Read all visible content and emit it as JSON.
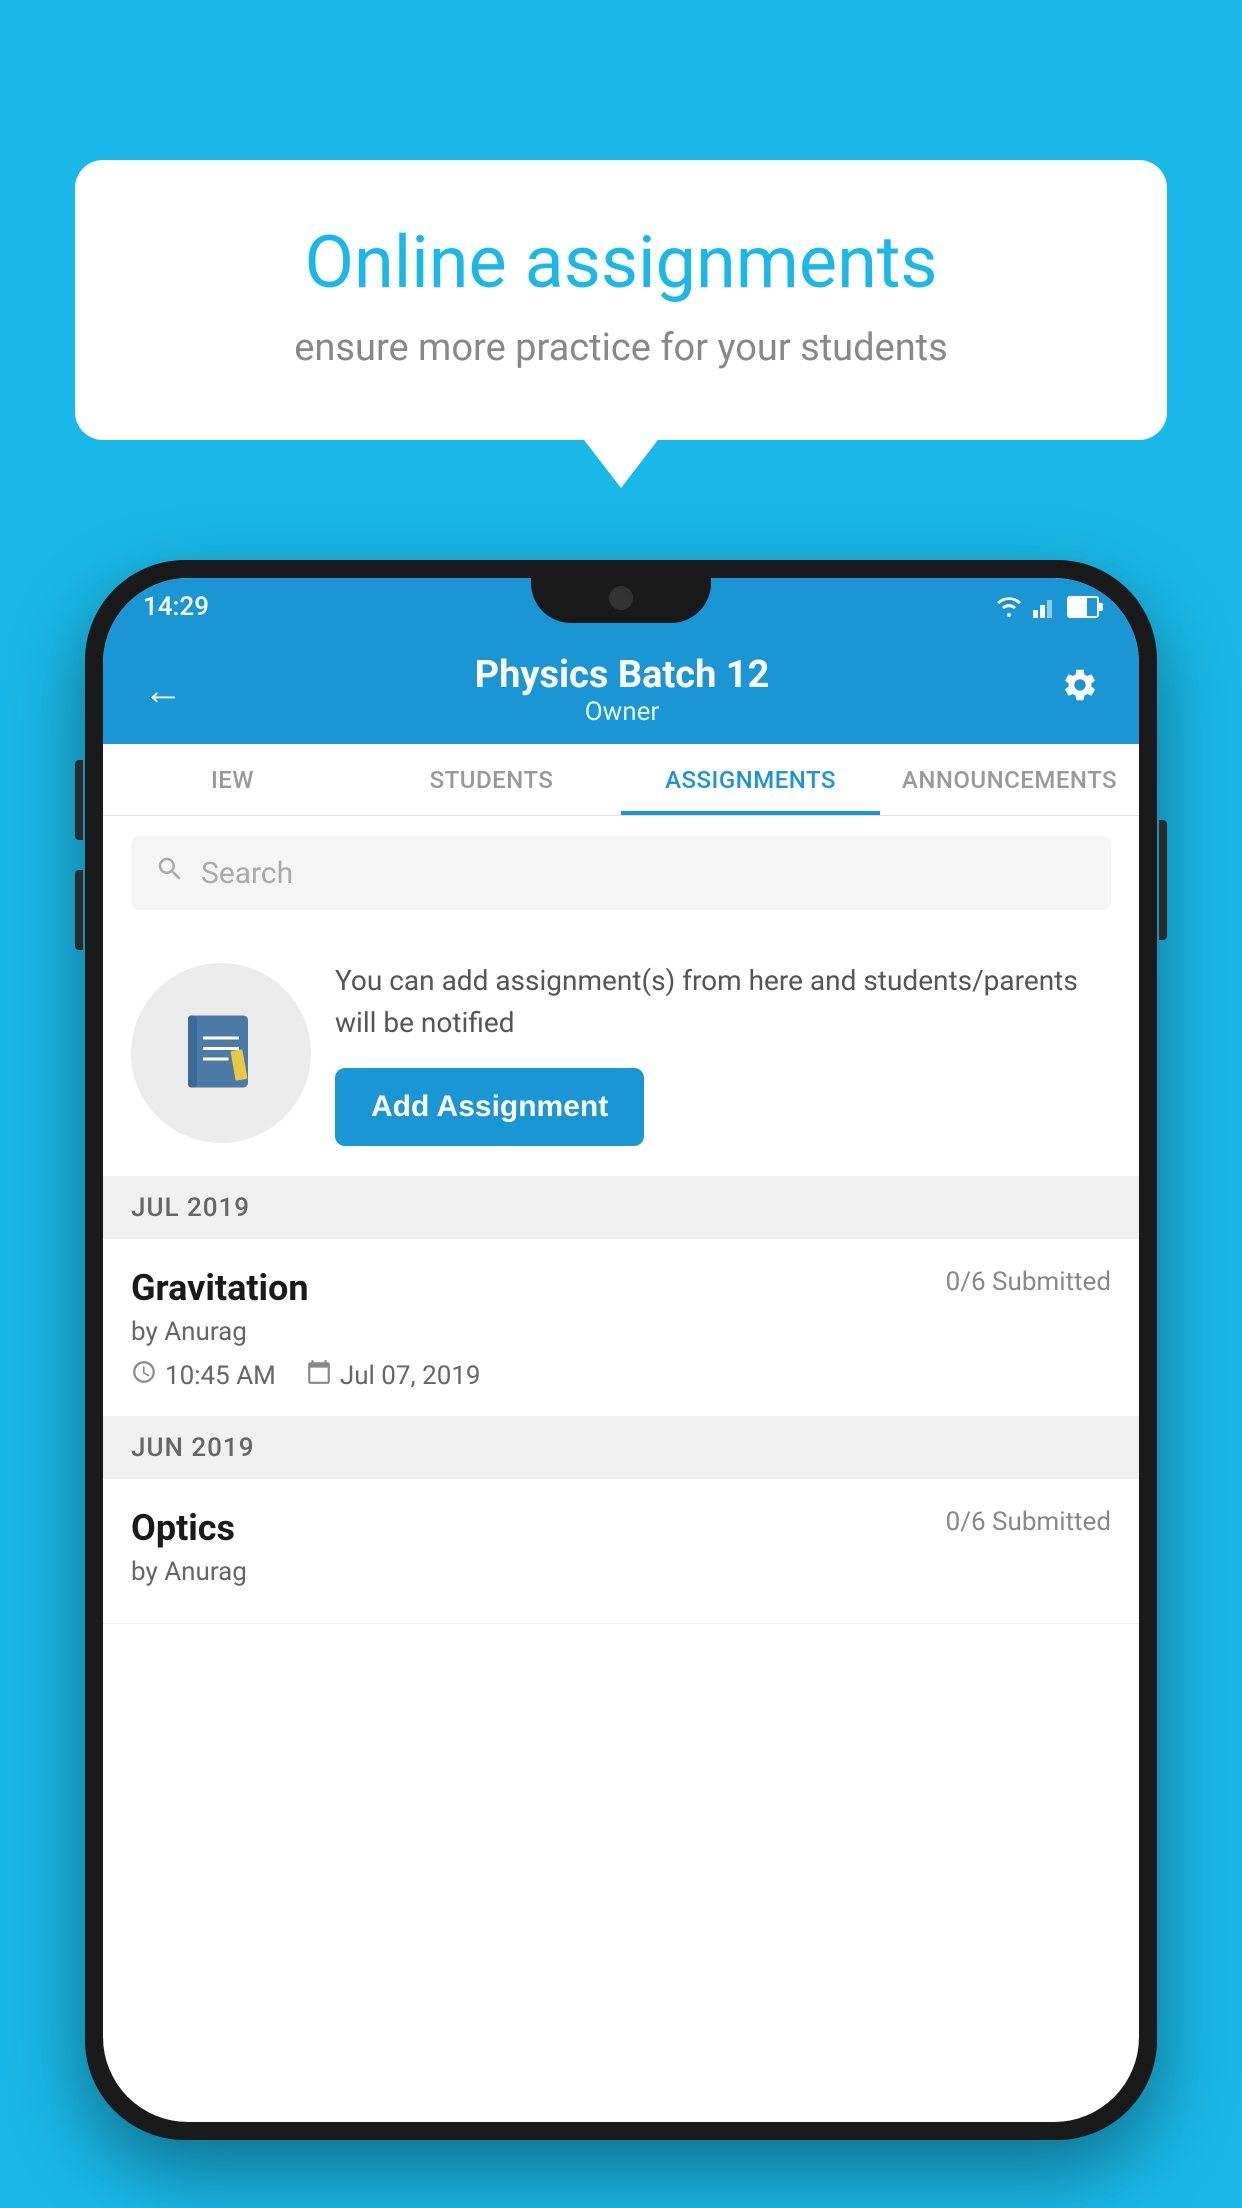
{
  "background": {
    "color": "#1ab8e8"
  },
  "speech_bubble": {
    "title": "Online assignments",
    "subtitle": "ensure more practice for your students"
  },
  "status_bar": {
    "time": "14:29",
    "wifi": "wifi",
    "signal": "signal",
    "battery": "battery"
  },
  "app_header": {
    "back_icon": "←",
    "title": "Physics Batch 12",
    "subtitle": "Owner",
    "settings_icon": "⚙"
  },
  "tabs": {
    "items": [
      {
        "label": "IEW",
        "active": false
      },
      {
        "label": "STUDENTS",
        "active": false
      },
      {
        "label": "ASSIGNMENTS",
        "active": true
      },
      {
        "label": "ANNOUNCEMENTS",
        "active": false
      }
    ]
  },
  "search": {
    "placeholder": "Search",
    "icon": "🔍"
  },
  "promo_card": {
    "description": "You can add assignment(s) from here and students/parents will be notified",
    "add_button_label": "Add Assignment"
  },
  "sections": [
    {
      "label": "JUL 2019",
      "assignments": [
        {
          "name": "Gravitation",
          "submitted": "0/6 Submitted",
          "by": "by Anurag",
          "time": "10:45 AM",
          "date": "Jul 07, 2019"
        }
      ]
    },
    {
      "label": "JUN 2019",
      "assignments": [
        {
          "name": "Optics",
          "submitted": "0/6 Submitted",
          "by": "by Anurag",
          "time": "",
          "date": ""
        }
      ]
    }
  ]
}
